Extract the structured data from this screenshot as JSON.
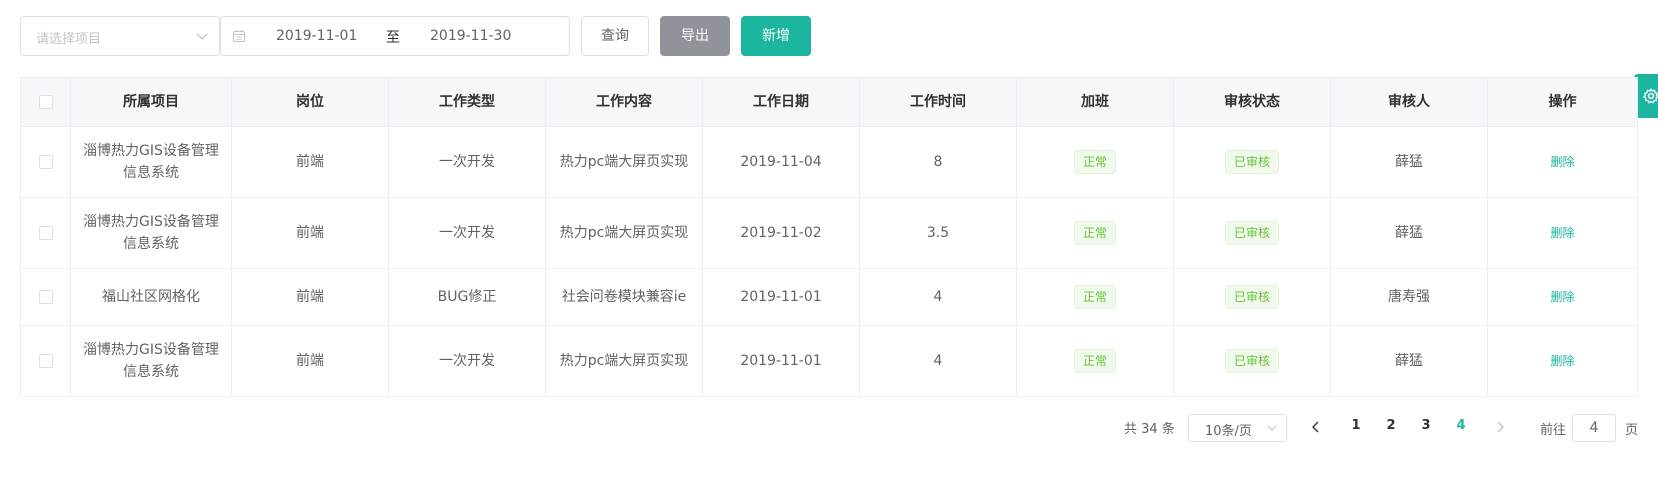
{
  "filters": {
    "project_placeholder": "请选择项目",
    "date_start": "2019-11-01",
    "date_separator": "至",
    "date_end": "2019-11-30"
  },
  "toolbar": {
    "query_label": "查询",
    "export_label": "导出",
    "add_label": "新增"
  },
  "colors": {
    "primary": "#1cb59f",
    "export_gray": "#909399",
    "tag_green": "#67c23a"
  },
  "table": {
    "columns": [
      "所属项目",
      "岗位",
      "工作类型",
      "工作内容",
      "工作日期",
      "工作时间",
      "加班",
      "审核状态",
      "审核人",
      "操作"
    ],
    "rows": [
      {
        "project": "淄博热力GIS设备管理信息系统",
        "position": "前端",
        "type": "一次开发",
        "content": "热力pc端大屏页实现",
        "date": "2019-11-04",
        "hours": "8",
        "overtime": "正常",
        "status": "已审核",
        "reviewer": "薛猛",
        "action": "删除"
      },
      {
        "project": "淄博热力GIS设备管理信息系统",
        "position": "前端",
        "type": "一次开发",
        "content": "热力pc端大屏页实现",
        "date": "2019-11-02",
        "hours": "3.5",
        "overtime": "正常",
        "status": "已审核",
        "reviewer": "薛猛",
        "action": "删除"
      },
      {
        "project": "福山社区网格化",
        "position": "前端",
        "type": "BUG修正",
        "content": "社会问卷模块兼容ie",
        "date": "2019-11-01",
        "hours": "4",
        "overtime": "正常",
        "status": "已审核",
        "reviewer": "唐寿强",
        "action": "删除"
      },
      {
        "project": "淄博热力GIS设备管理信息系统",
        "position": "前端",
        "type": "一次开发",
        "content": "热力pc端大屏页实现",
        "date": "2019-11-01",
        "hours": "4",
        "overtime": "正常",
        "status": "已审核",
        "reviewer": "薛猛",
        "action": "删除"
      }
    ]
  },
  "pagination": {
    "total_text": "共 34 条",
    "page_size": "10条/页",
    "pages": [
      "1",
      "2",
      "3",
      "4"
    ],
    "current_page": "4",
    "goto_label": "前往",
    "goto_value": "4",
    "goto_suffix": "页"
  },
  "icons": {
    "select_chevron": "chevron-down-icon",
    "calendar": "calendar-icon",
    "settings": "gear-icon",
    "prev": "chevron-left-icon",
    "next": "chevron-right-icon"
  }
}
